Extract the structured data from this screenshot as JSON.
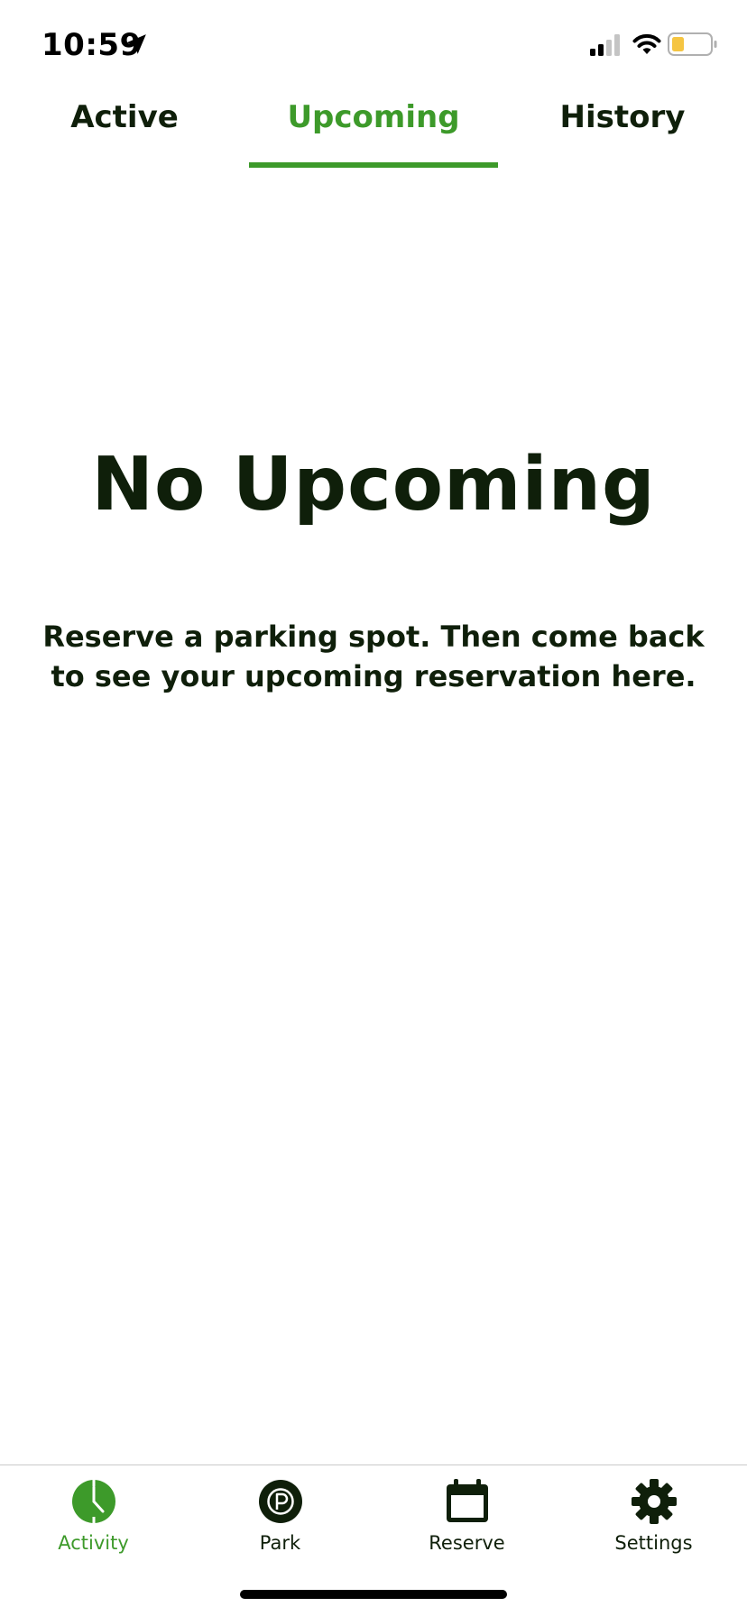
{
  "status_bar": {
    "time": "10:59",
    "icons": [
      "location-arrow-icon",
      "cellular-signal-icon",
      "wifi-icon",
      "battery-icon"
    ]
  },
  "tabs": [
    {
      "label": "Active",
      "selected": false
    },
    {
      "label": "Upcoming",
      "selected": true
    },
    {
      "label": "History",
      "selected": false
    }
  ],
  "empty_state": {
    "title": "No Upcoming",
    "message": "Reserve a parking spot. Then come back to see your upcoming reservation here."
  },
  "bottom_nav": {
    "items": [
      {
        "label": "Activity",
        "icon": "clock-icon",
        "selected": true
      },
      {
        "label": "Park",
        "icon": "parking-icon",
        "selected": false
      },
      {
        "label": "Reserve",
        "icon": "calendar-icon",
        "selected": false
      },
      {
        "label": "Settings",
        "icon": "gear-icon",
        "selected": false
      }
    ]
  },
  "colors": {
    "accent": "#3d9a2a",
    "text": "#0f1f0a",
    "battery_fill": "#f5c542"
  }
}
